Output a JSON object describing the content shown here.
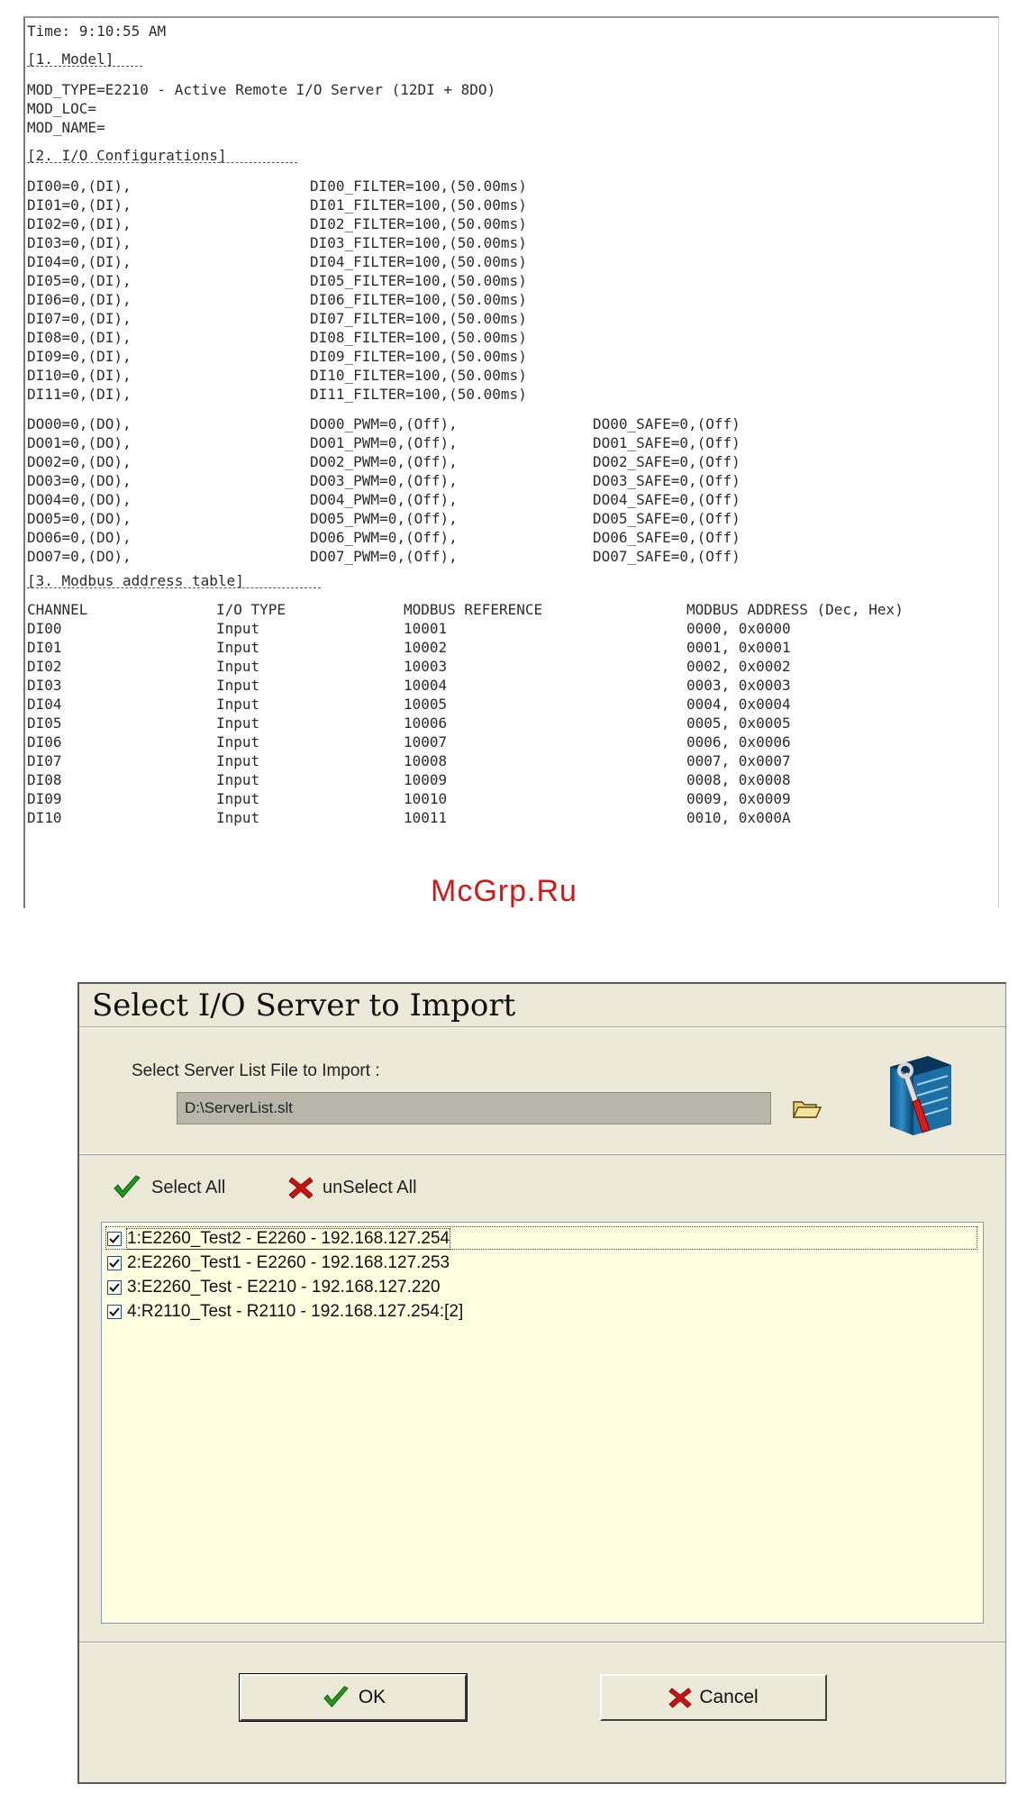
{
  "report": {
    "header_lines": [
      "Time: 9:10:55 AM",
      "",
      "[1. Model]",
      "",
      "MOD_TYPE=E2210 - Active Remote I/O Server (12DI + 8DO)",
      "MOD_LOC=",
      "MOD_NAME=",
      "",
      "[2. I/O Configurations]"
    ],
    "di_rows": [
      [
        "DI00=0,(DI),",
        "DI00_FILTER=100,(50.00ms)"
      ],
      [
        "DI01=0,(DI),",
        "DI01_FILTER=100,(50.00ms)"
      ],
      [
        "DI02=0,(DI),",
        "DI02_FILTER=100,(50.00ms)"
      ],
      [
        "DI03=0,(DI),",
        "DI03_FILTER=100,(50.00ms)"
      ],
      [
        "DI04=0,(DI),",
        "DI04_FILTER=100,(50.00ms)"
      ],
      [
        "DI05=0,(DI),",
        "DI05_FILTER=100,(50.00ms)"
      ],
      [
        "DI06=0,(DI),",
        "DI06_FILTER=100,(50.00ms)"
      ],
      [
        "DI07=0,(DI),",
        "DI07_FILTER=100,(50.00ms)"
      ],
      [
        "DI08=0,(DI),",
        "DI08_FILTER=100,(50.00ms)"
      ],
      [
        "DI09=0,(DI),",
        "DI09_FILTER=100,(50.00ms)"
      ],
      [
        "DI10=0,(DI),",
        "DI10_FILTER=100,(50.00ms)"
      ],
      [
        "DI11=0,(DI),",
        "DI11_FILTER=100,(50.00ms)"
      ]
    ],
    "do_rows": [
      [
        "DO00=0,(DO),",
        "DO00_PWM=0,(Off),",
        "DO00_SAFE=0,(Off)"
      ],
      [
        "DO01=0,(DO),",
        "DO01_PWM=0,(Off),",
        "DO01_SAFE=0,(Off)"
      ],
      [
        "DO02=0,(DO),",
        "DO02_PWM=0,(Off),",
        "DO02_SAFE=0,(Off)"
      ],
      [
        "DO03=0,(DO),",
        "DO03_PWM=0,(Off),",
        "DO03_SAFE=0,(Off)"
      ],
      [
        "DO04=0,(DO),",
        "DO04_PWM=0,(Off),",
        "DO04_SAFE=0,(Off)"
      ],
      [
        "DO05=0,(DO),",
        "DO05_PWM=0,(Off),",
        "DO05_SAFE=0,(Off)"
      ],
      [
        "DO06=0,(DO),",
        "DO06_PWM=0,(Off),",
        "DO06_SAFE=0,(Off)"
      ],
      [
        "DO07=0,(DO),",
        "DO07_PWM=0,(Off),",
        "DO07_SAFE=0,(Off)"
      ]
    ],
    "modbus_title": "[3. Modbus address table]",
    "modbus_headers": [
      "CHANNEL",
      "I/O TYPE",
      "MODBUS REFERENCE",
      "MODBUS ADDRESS (Dec, Hex)"
    ],
    "modbus_rows": [
      [
        "DI00",
        "Input",
        "10001",
        "0000, 0x0000"
      ],
      [
        "DI01",
        "Input",
        "10002",
        "0001, 0x0001"
      ],
      [
        "DI02",
        "Input",
        "10003",
        "0002, 0x0002"
      ],
      [
        "DI03",
        "Input",
        "10004",
        "0003, 0x0003"
      ],
      [
        "DI04",
        "Input",
        "10005",
        "0004, 0x0004"
      ],
      [
        "DI05",
        "Input",
        "10006",
        "0005, 0x0005"
      ],
      [
        "DI06",
        "Input",
        "10007",
        "0006, 0x0006"
      ],
      [
        "DI07",
        "Input",
        "10008",
        "0007, 0x0007"
      ],
      [
        "DI08",
        "Input",
        "10009",
        "0008, 0x0008"
      ],
      [
        "DI09",
        "Input",
        "10010",
        "0009, 0x0009"
      ],
      [
        "DI10",
        "Input",
        "10011",
        "0010, 0x000A"
      ]
    ]
  },
  "watermark": "McGrp.Ru",
  "dialog": {
    "title": "Select I/O Server to Import",
    "file_label": "Select Server List File to Import :",
    "file_value": "D:\\ServerList.slt",
    "select_all_label": "Select All",
    "unselect_all_label": "unSelect All",
    "servers": [
      {
        "label": "1:E2260_Test2 - E2260 - 192.168.127.254",
        "checked": true
      },
      {
        "label": "2:E2260_Test1 - E2260 - 192.168.127.253",
        "checked": true
      },
      {
        "label": "3:E2260_Test - E2210 - 192.168.127.220",
        "checked": true
      },
      {
        "label": "4:R2110_Test - R2110 - 192.168.127.254:[2]",
        "checked": true
      }
    ],
    "ok_label": "OK",
    "cancel_label": "Cancel",
    "colors": {
      "list_bg": "#ffffe1",
      "check_green": "#1f9a1f",
      "cross_red": "#cc1111",
      "face": "#ece9d8"
    }
  }
}
